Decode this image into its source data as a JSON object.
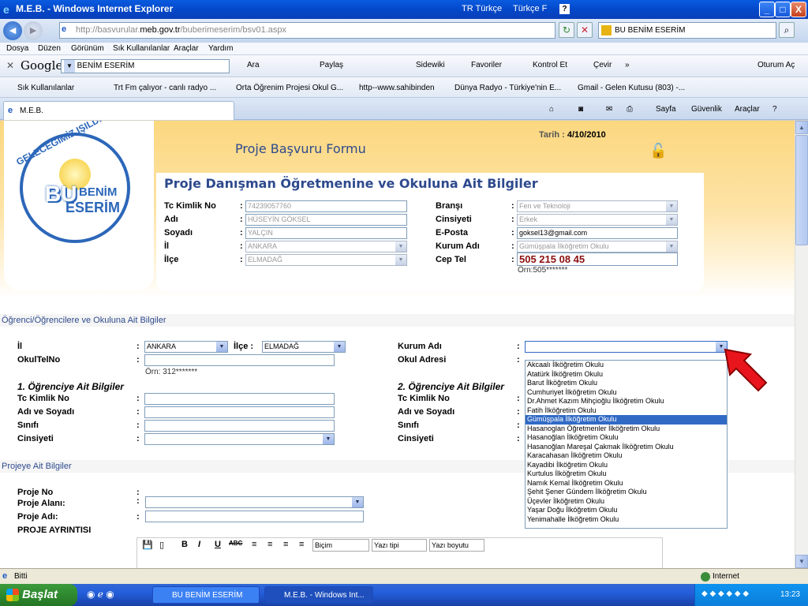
{
  "window": {
    "title": "M.E.B. - Windows Internet Explorer",
    "lang": "TR Türkçe",
    "keyboard": "Türkçe F",
    "help": "?",
    "min": "_",
    "max": "□",
    "close": "X"
  },
  "address": {
    "url_prefix": "http://basvurular.",
    "url_domain": "meb.gov.tr",
    "url_path": "/buberimeserim/bsv01.aspx",
    "search_value": "BU BENİM ESERİM"
  },
  "menu": [
    "Dosya",
    "Düzen",
    "Görünüm",
    "Sık Kullanılanlar",
    "Araçlar",
    "Yardım"
  ],
  "google_toolbar": {
    "logo": "Google",
    "search_value": "BU BENİM ESERİM",
    "items": [
      "Ara",
      "Paylaş",
      "Sidewiki",
      "Favoriler",
      "Kontrol Et",
      "Çevir",
      "»",
      "Oturum Aç"
    ]
  },
  "favorites": [
    "Sık Kullanılanlar",
    "Trt Fm çalıyor - canlı radyo ...",
    "Orta Öğrenim Projesi Okul G...",
    "http--www.sahibinden",
    "Dünya Radyo - Türkiye'nin E...",
    "Gmail - Gelen Kutusu (803) -..."
  ],
  "tab": {
    "label": "M.E.B."
  },
  "tab_tools": [
    "Sayfa",
    "Güvenlik",
    "Araçlar"
  ],
  "page": {
    "form_title": "Proje Başvuru Formu",
    "date_label": "Tarih :",
    "date_value": "4/10/2010",
    "logo_arc": "GELECEĞİMİZ IŞILDIYOR",
    "logo_bu": "BU",
    "logo_benim": "BENİM",
    "logo_eserim": "ESERİM",
    "advisor_title": "Proje Danışman Öğretmenine ve Okuluna Ait Bilgiler",
    "advisor": {
      "tc_label": "Tc Kimlik No",
      "tc_value": "74239057760",
      "adi_label": "Adı",
      "adi_value": "HÜSEYİN GÖKSEL",
      "soyadi_label": "Soyadı",
      "soyadi_value": "YALÇIN",
      "il_label": "İl",
      "il_value": "ANKARA",
      "ilce_label": "İlçe",
      "ilce_value": "ELMADAĞ",
      "brans_label": "Branşı",
      "brans_value": "Fen ve Teknoloji",
      "cins_label": "Cinsiyeti",
      "cins_value": "Erkek",
      "eposta_label": "E-Posta",
      "eposta_value": "goksel13@gmail.com",
      "kurum_label": "Kurum Adı",
      "kurum_value": "Gümüşpala İlköğretim Okulu",
      "ceptel_label": "Cep Tel",
      "ceptel_value": "505 215 08 45",
      "ceptel_hint": "Örn:505*******"
    },
    "students_section": "Öğrenci/Öğrencilere ve Okuluna Ait Bilgiler",
    "students": {
      "il_label": "İl",
      "il_value": "ANKARA",
      "ilce_label": "İlçe :",
      "ilce_value": "ELMADAĞ",
      "kurum_label": "Kurum Adı",
      "okultel_label": "OkulTelNo",
      "okultel_hint": "Örn: 312*******",
      "adres_label": "Okul Adresi",
      "s1_title": "1. Öğrenciye Ait Bilgiler",
      "s2_title": "2. Öğrenciye Ait Bilgiler",
      "tc_label": "Tc Kimlik No",
      "adsoyad_label": "Adı ve Soyadı",
      "sinif_label": "Sınıfı",
      "cins_label": "Cinsiyeti"
    },
    "project_section": "Projeye Ait Bilgiler",
    "project": {
      "no_label": "Proje No",
      "alan_label": "Proje Alanı:",
      "adi_label": "Proje Adı:",
      "ayrinti_label": "PROJE AYRINTISI"
    },
    "rte": {
      "style": "Biçim",
      "font": "Yazı tipi",
      "size": "Yazı boyutu"
    },
    "school_options": [
      "Akcaalı İlköğretim Okulu",
      "Atatürk İlköğretim Okulu",
      "Barut İlköğretim Okulu",
      "Cumhuriyet İlköğretim Okulu",
      "Dr.Ahmet Kazım Mihçioğlu İlköğretim Okulu",
      "Fatih İlköğretim Okulu",
      "Gümüşpala İlköğretim Okulu",
      "Hasanoglan Öğretmenler İlköğretim Okulu",
      "Hasanoğlan İlköğretim Okulu",
      "Hasanoğlan Mareşal Çakmak İlköğretim Okulu",
      "Karacahasan İlköğretim Okulu",
      "Kayadibi İlköğretim Okulu",
      "Kurtulus İlköğretim Okulu",
      "Namık Kemal İlköğretim Okulu",
      "Şehit Şener Gündem İlköğretim Okulu",
      "Üçevler İlköğretim Okulu",
      "Yaşar Doğu İlköğretim Okulu",
      "Yenimahalle İlköğretim Okulu"
    ],
    "selected_option_index": 6
  },
  "status": {
    "text": "Bitti",
    "zone": "Internet"
  },
  "taskbar": {
    "start": "Başlat",
    "buttons": [
      "BU BENİM ESERİM",
      "M.E.B. - Windows Int..."
    ],
    "clock": "13:23"
  }
}
